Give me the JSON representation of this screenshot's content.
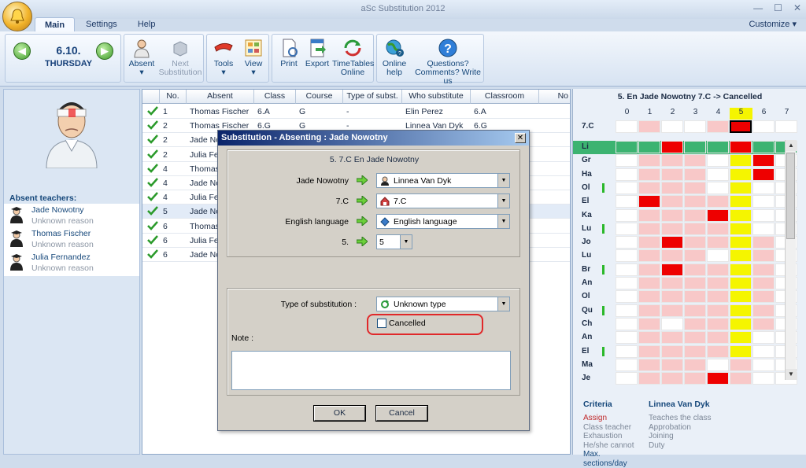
{
  "window": {
    "title": "aSc Substitution 2012",
    "tabs": [
      "Main",
      "Settings",
      "Help"
    ],
    "active_tab": "Main",
    "customize": "Customize"
  },
  "ribbon": {
    "date": "6.10.",
    "day": "THURSDAY",
    "absent": "Absent",
    "next1": "Next",
    "next2": "Substitution",
    "tools": "Tools",
    "view": "View",
    "print": "Print",
    "export": "Export",
    "tt1": "TimeTables",
    "tt2": "Online",
    "oh1": "Online",
    "oh2": "help",
    "q1": "Questions?",
    "q2": "Comments? Write us"
  },
  "absent_panel": {
    "title": "Absent teachers:",
    "teachers": [
      {
        "name": "Jade Nowotny",
        "reason": "Unknown reason"
      },
      {
        "name": "Thomas Fischer",
        "reason": "Unknown reason"
      },
      {
        "name": "Julia Fernandez",
        "reason": "Unknown reason"
      }
    ]
  },
  "table": {
    "columns": [
      "No.",
      "Absent",
      "Class",
      "Course",
      "Type of subst.",
      "Who substitute",
      "Classroom",
      "No"
    ],
    "rows": [
      {
        "no": "1",
        "absent": "Thomas Fischer",
        "class": "6.A",
        "course": "G",
        "type": "-",
        "who": "Elin Perez",
        "room": "6.A"
      },
      {
        "no": "2",
        "absent": "Thomas Fischer",
        "class": "6.G",
        "course": "G",
        "type": "-",
        "who": "Linnea Van Dyk",
        "room": "6.G"
      },
      {
        "no": "2",
        "absent": "Jade Nov",
        "class": "",
        "course": "",
        "type": "",
        "who": "",
        "room": ""
      },
      {
        "no": "2",
        "absent": "Julia Fer",
        "class": "",
        "course": "",
        "type": "",
        "who": "",
        "room": ""
      },
      {
        "no": "4",
        "absent": "Thomas",
        "class": "",
        "course": "",
        "type": "",
        "who": "",
        "room": ""
      },
      {
        "no": "4",
        "absent": "Jade Nov",
        "class": "",
        "course": "",
        "type": "",
        "who": "",
        "room": ""
      },
      {
        "no": "4",
        "absent": "Julia Fer",
        "class": "",
        "course": "",
        "type": "",
        "who": "",
        "room": ""
      },
      {
        "no": "5",
        "absent": "Jade Nov",
        "class": "",
        "course": "",
        "type": "",
        "who": "",
        "room": ""
      },
      {
        "no": "6",
        "absent": "Thomas",
        "class": "",
        "course": "",
        "type": "",
        "who": "",
        "room": ""
      },
      {
        "no": "6",
        "absent": "Julia Fer",
        "class": "",
        "course": "",
        "type": "",
        "who": "",
        "room": ""
      },
      {
        "no": "6",
        "absent": "Jade Nov",
        "class": "",
        "course": "",
        "type": "",
        "who": "",
        "room": ""
      }
    ],
    "selected_row": 7
  },
  "timetable": {
    "title": "5. En Jade Nowotny 7.C -> Cancelled",
    "periods": [
      "0",
      "1",
      "2",
      "3",
      "4",
      "5",
      "6",
      "7"
    ],
    "highlight_period": 5,
    "class_row": "7.C",
    "teachers": [
      "Li",
      "Gr",
      "Ha",
      "Ol",
      "El",
      "Ka",
      "Lu",
      "Jo",
      "Lu",
      "Br",
      "An",
      "Ol",
      "Qu",
      "Ch",
      "An",
      "El",
      "Ma",
      "Je"
    ],
    "colors": {
      "red": "#ee0000",
      "pink": "#f8c8c8",
      "yellow": "#f5f500",
      "green": "#3cb371",
      "white": "#ffffff"
    }
  },
  "criteria": {
    "title": "Criteria",
    "teacher": "Linnea Van Dyk",
    "left": [
      "Assign",
      "Class teacher",
      "Exhaustion",
      "He/she cannot",
      "Max. sections/day"
    ],
    "right": [
      "Teaches the class",
      "Approbation",
      "Joining",
      "Duty"
    ]
  },
  "dialog": {
    "title": "Substitution - Absenting : Jade Nowotny",
    "header": "5. 7.C  En Jade Nowotny",
    "rows": [
      {
        "label": "Jade Nowotny",
        "value": "Linnea Van Dyk"
      },
      {
        "label": "7.C",
        "value": "7.C"
      },
      {
        "label": "English language",
        "value": "English language"
      }
    ],
    "period_label": "5.",
    "period_value": "5",
    "type_label": "Type of substitution :",
    "type_value": "Unknown type",
    "cancelled_label": "Cancelled",
    "note_label": "Note :",
    "ok": "OK",
    "cancel": "Cancel"
  }
}
